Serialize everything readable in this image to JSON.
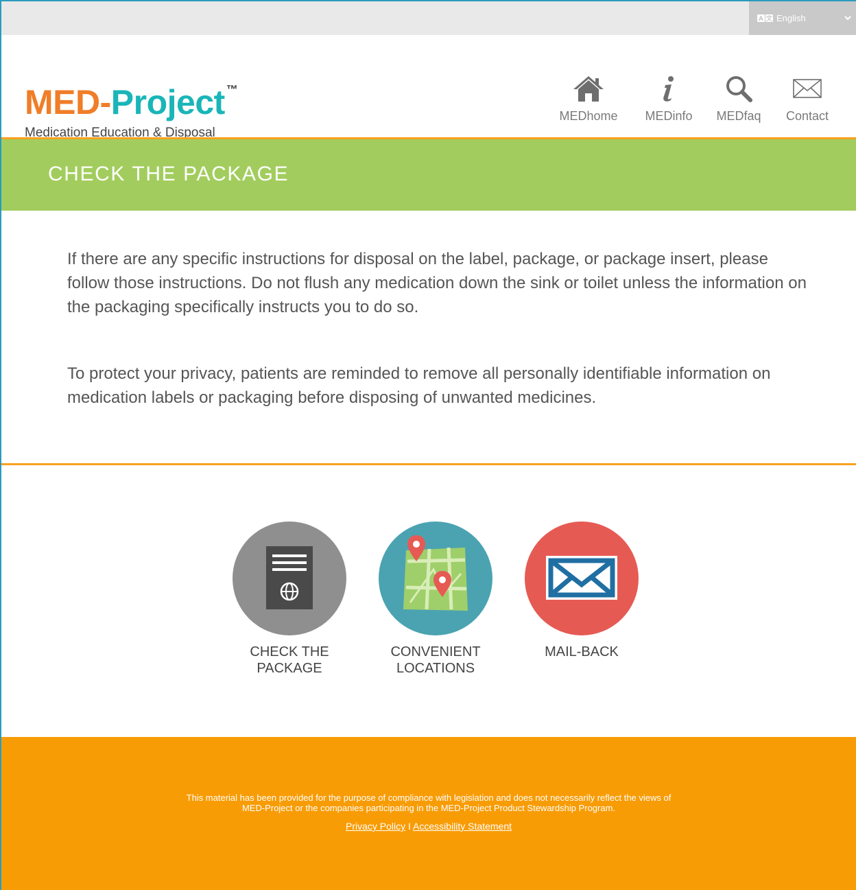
{
  "language_selector": {
    "label": "English",
    "icon": "translate-icon"
  },
  "logo": {
    "name_part1": "MED-",
    "name_part2": "Project",
    "trademark": "™",
    "tagline": "Medication Education & Disposal"
  },
  "nav": [
    {
      "label": "MEDhome",
      "icon": "home-icon"
    },
    {
      "label": "MEDinfo",
      "icon": "info-icon"
    },
    {
      "label": "MEDfaq",
      "icon": "search-icon"
    },
    {
      "label": "Contact",
      "icon": "envelope-icon"
    }
  ],
  "banner": {
    "title": "CHECK THE PACKAGE"
  },
  "content": {
    "paragraph1": "If there are any specific instructions for disposal on the label, package, or package insert, please follow those instructions. Do not flush any medication down the sink or toilet unless the information on the packaging specifically instructs you to do so.",
    "paragraph2": "To protect your privacy, patients are reminded to remove all personally identifiable information on medication labels or packaging before disposing of unwanted medicines."
  },
  "tiles": [
    {
      "line1": "CHECK THE",
      "line2": "PACKAGE",
      "icon": "package-icon",
      "color": "#8f8f8f"
    },
    {
      "line1": "CONVENIENT",
      "line2": "LOCATIONS",
      "icon": "map-icon",
      "color": "#4ba3b1"
    },
    {
      "line1": "MAIL-BACK",
      "line2": "",
      "icon": "mail-icon",
      "color": "#e65a54"
    }
  ],
  "footer": {
    "disclaimer_line1": "This material has been provided for the purpose of compliance with legislation and does not necessarily reflect the views of",
    "disclaimer_line2": "MED-Project or the companies participating in the MED-Project Product Stewardship Program.",
    "privacy_link": "Privacy Policy",
    "separator": " I ",
    "accessibility_link": "Accessibility Statement"
  },
  "colors": {
    "brand_orange": "#f07d28",
    "brand_teal": "#1ab5b8",
    "banner_green": "#a2cd5e",
    "accent_line": "#f8a11f",
    "footer": "#f89c06"
  }
}
